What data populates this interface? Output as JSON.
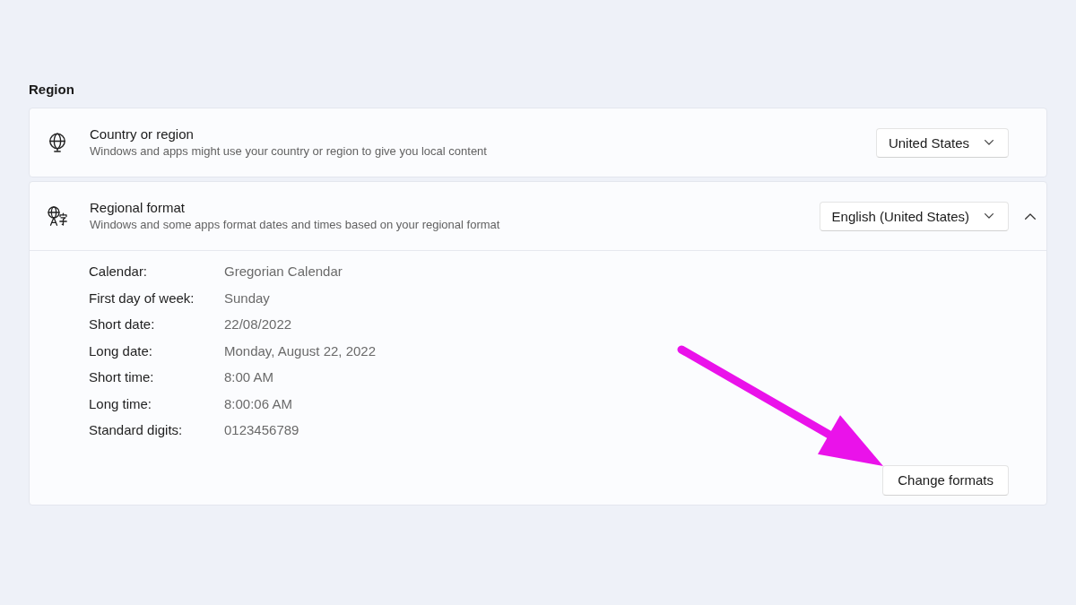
{
  "section": {
    "title": "Region"
  },
  "country_or_region": {
    "title": "Country or region",
    "description": "Windows and apps might use your country or region to give you local content",
    "dropdown": "United States"
  },
  "regional_format": {
    "title": "Regional format",
    "description": "Windows and some apps format dates and times based on your regional format",
    "dropdown": "English (United States)",
    "expanded": true,
    "details": [
      {
        "label": "Calendar:",
        "value": "Gregorian Calendar"
      },
      {
        "label": "First day of week:",
        "value": "Sunday"
      },
      {
        "label": "Short date:",
        "value": "22/08/2022"
      },
      {
        "label": "Long date:",
        "value": "Monday, August 22, 2022"
      },
      {
        "label": "Short time:",
        "value": "8:00 AM"
      },
      {
        "label": "Long time:",
        "value": "8:00:06 AM"
      },
      {
        "label": "Standard digits:",
        "value": "0123456789"
      }
    ],
    "button": "Change formats"
  }
}
